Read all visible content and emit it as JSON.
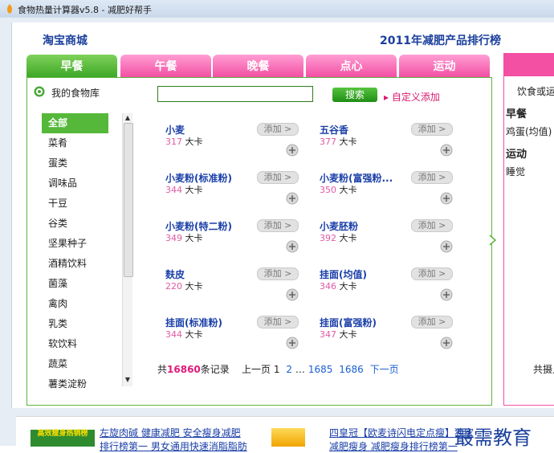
{
  "window": {
    "title": "食物热量计算器v5.8 - 减肥好帮手"
  },
  "header": {
    "taobao_link": "淘宝商城",
    "ranking_link": "2011年减肥产品排行榜"
  },
  "tabs": [
    "早餐",
    "午餐",
    "晚餐",
    "点心",
    "运动"
  ],
  "library": {
    "label": "我的食物库",
    "search_placeholder": "",
    "search_button": "搜索",
    "custom_add": "自定义添加"
  },
  "categories": [
    "全部",
    "菜肴",
    "蛋类",
    "调味品",
    "干豆",
    "谷类",
    "坚果种子",
    "酒精饮料",
    "菌藻",
    "禽肉",
    "乳类",
    "软饮料",
    "蔬菜",
    "薯类淀粉"
  ],
  "foods": [
    {
      "name": "小麦",
      "kcal": "317",
      "unit": "大卡"
    },
    {
      "name": "五谷香",
      "kcal": "377",
      "unit": "大卡"
    },
    {
      "name": "小麦粉(标准粉)",
      "kcal": "344",
      "unit": "大卡"
    },
    {
      "name": "小麦粉(富强粉...",
      "kcal": "350",
      "unit": "大卡"
    },
    {
      "name": "小麦粉(特二粉)",
      "kcal": "349",
      "unit": "大卡"
    },
    {
      "name": "小麦胚粉",
      "kcal": "392",
      "unit": "大卡"
    },
    {
      "name": "麸皮",
      "kcal": "220",
      "unit": "大卡"
    },
    {
      "name": "挂面(均值)",
      "kcal": "346",
      "unit": "大卡"
    },
    {
      "name": "挂面(标准粉)",
      "kcal": "344",
      "unit": "大卡"
    },
    {
      "name": "挂面(富强粉)",
      "kcal": "347",
      "unit": "大卡"
    }
  ],
  "add_label": "添加 >",
  "pager": {
    "prefix": "共",
    "count": "16860",
    "suffix": "条记录",
    "prev": "上一页",
    "p1": "1",
    "p2": "2",
    "ellipsis": "…",
    "p1685": "1685",
    "p1686": "1686",
    "next": "下一页"
  },
  "right_panel": {
    "diet_label": "饮食或运",
    "breakfast": "早餐",
    "breakfast_item": "鸡蛋(均值)",
    "exercise": "运动",
    "exercise_item": "睡觉",
    "total": "共摄入"
  },
  "ads": {
    "ad1_img": "高效瘦身热销榜",
    "ad1_line1": "左旋肉碱 健康减肥 安全瘦身减肥",
    "ad1_line2": "排行榜第一 男女通用快速消脂脂肪",
    "ad2_line1": "四皇冠【欧麦诗闪电定点瘦】独家",
    "ad2_line2": "减肥瘦身 减肥瘦身排行榜第一",
    "watermark": "最需教育"
  }
}
